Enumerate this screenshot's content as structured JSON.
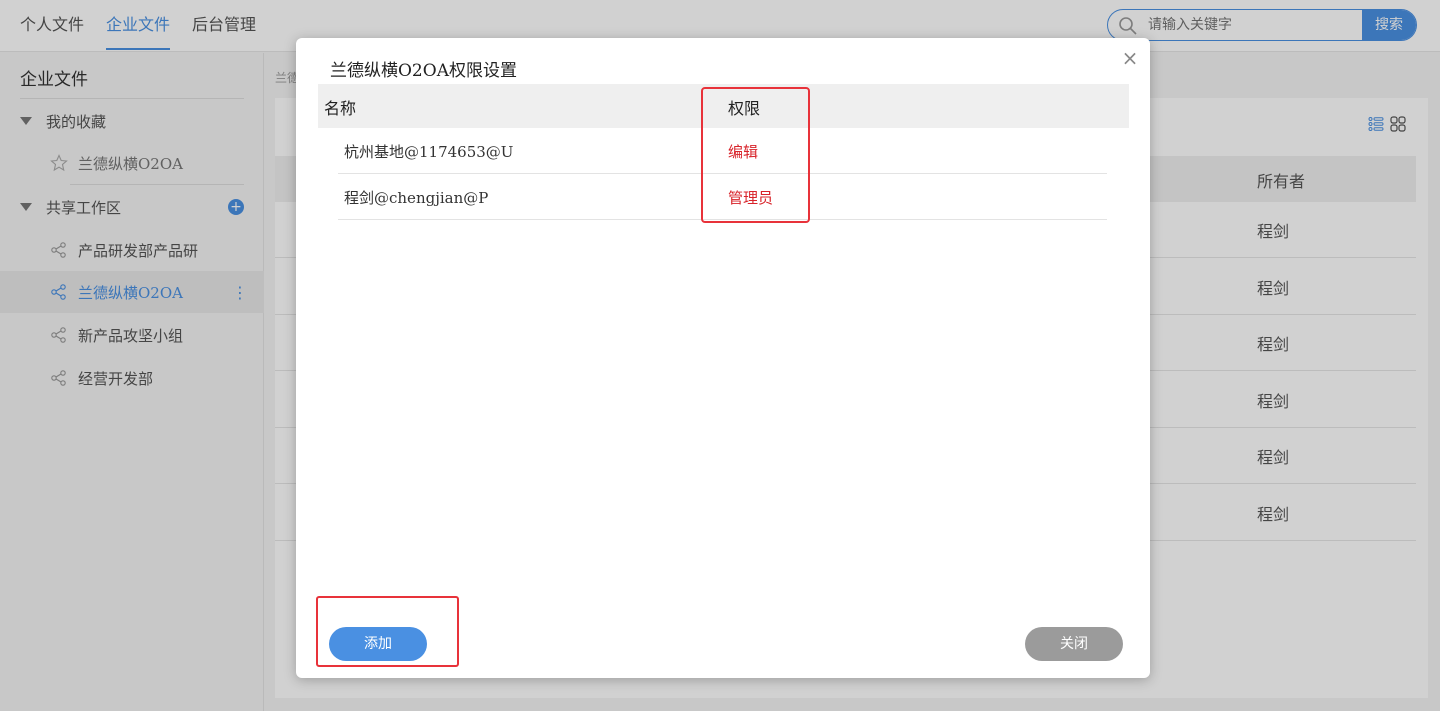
{
  "topnav": {
    "tabs": [
      {
        "label": "个人文件",
        "active": false
      },
      {
        "label": "企业文件",
        "active": true
      },
      {
        "label": "后台管理",
        "active": false
      }
    ]
  },
  "search": {
    "placeholder": "请输入关键字",
    "button_label": "搜索"
  },
  "sidebar": {
    "title": "企业文件",
    "favorites": {
      "label": "我的收藏",
      "items": [
        {
          "label": "兰德纵横O2OA",
          "icon": "star-outline-icon"
        }
      ]
    },
    "shared": {
      "label": "共享工作区",
      "items": [
        {
          "label": "产品研发部产品研",
          "icon": "share-icon",
          "active": false
        },
        {
          "label": "兰德纵横O2OA",
          "icon": "share-icon",
          "active": true
        },
        {
          "label": "新产品攻坚小组",
          "icon": "share-icon",
          "active": false
        },
        {
          "label": "经营开发部",
          "icon": "share-icon",
          "active": false
        }
      ]
    }
  },
  "main": {
    "breadcrumb": "兰德",
    "owner_header": "所有者",
    "owners": [
      "程剑",
      "程剑",
      "程剑",
      "程剑",
      "程剑",
      "程剑"
    ]
  },
  "modal": {
    "title": "兰德纵横O2OA权限设置",
    "headers": {
      "name": "名称",
      "permission": "权限"
    },
    "rows": [
      {
        "name": "杭州基地@1174653@U",
        "permission": "编辑"
      },
      {
        "name": "程剑@chengjian@P",
        "permission": "管理员"
      }
    ],
    "add_label": "添加",
    "close_label": "关闭"
  },
  "colors": {
    "accent": "#4a90e2",
    "permission_text": "#d8232a",
    "highlight": "#e8323a",
    "close_button": "#9b9b9b"
  }
}
